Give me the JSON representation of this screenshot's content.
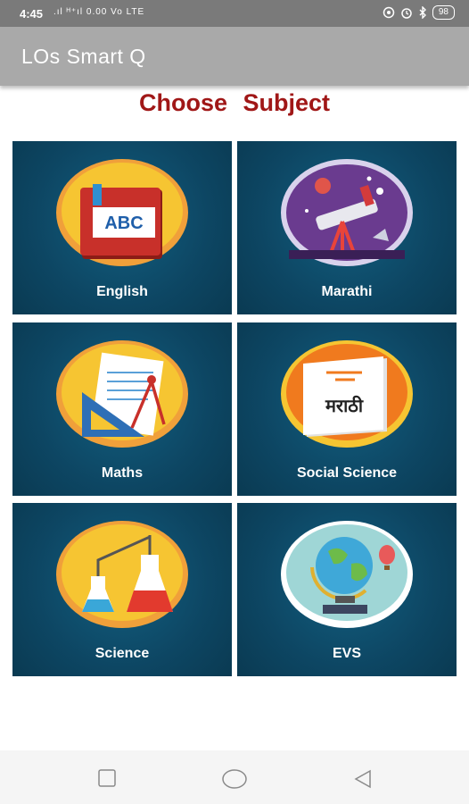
{
  "status": {
    "time": "4:45",
    "signal": ".ıl ᴴ⁺ıl 0.00 Vo LTE",
    "icons": [
      "sync-icon",
      "alarm-icon",
      "bluetooth-icon"
    ],
    "battery": "98"
  },
  "app": {
    "title": "LOs Smart Q"
  },
  "main": {
    "heading": "Choose  Subject",
    "subjects": [
      {
        "label": "English",
        "icon": "abc-book-icon"
      },
      {
        "label": "Marathi",
        "icon": "telescope-icon"
      },
      {
        "label": "Maths",
        "icon": "geometry-tools-icon"
      },
      {
        "label": "Social Science",
        "icon": "marathi-book-icon",
        "badge_text": "मराठी"
      },
      {
        "label": "Science",
        "icon": "lab-flask-icon"
      },
      {
        "label": "EVS",
        "icon": "globe-icon"
      }
    ]
  },
  "colors": {
    "app_bar": "#a9a9a9",
    "heading": "#a01717",
    "tile": "#0d4663"
  },
  "nav": {
    "icons": [
      "recent-apps-icon",
      "home-icon",
      "back-icon"
    ]
  }
}
